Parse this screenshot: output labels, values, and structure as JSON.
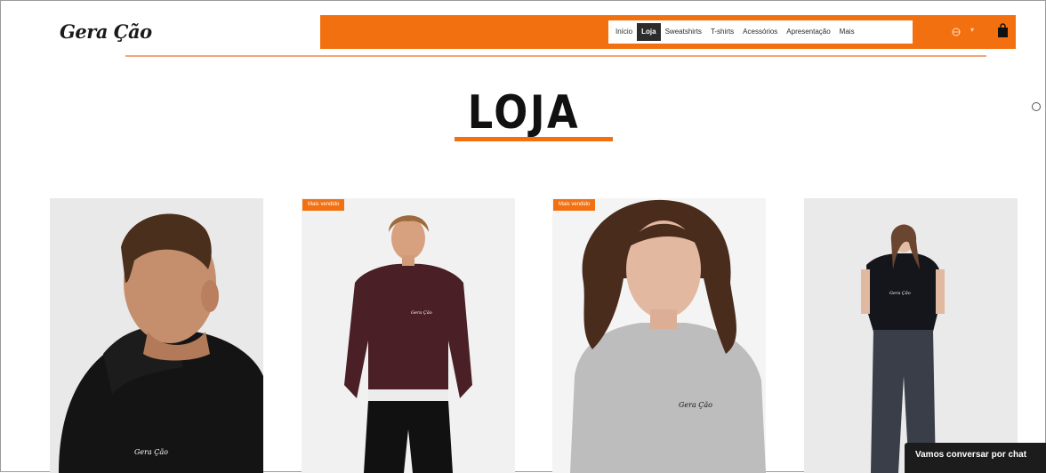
{
  "brand": {
    "logo_text": "Gera Ção"
  },
  "nav": {
    "items": [
      {
        "label": "Início",
        "active": false
      },
      {
        "label": "Loja",
        "active": true
      },
      {
        "label": "Sweatshirts",
        "active": false
      },
      {
        "label": "T-shirts",
        "active": false
      },
      {
        "label": "Acessórios",
        "active": false
      },
      {
        "label": "Apresentação",
        "active": false
      },
      {
        "label": "Mais",
        "active": false
      }
    ],
    "language_icon": "globe-icon",
    "cart_icon": "shopping-bag-icon"
  },
  "page": {
    "title": "LOJA"
  },
  "products": [
    {
      "badge": "",
      "name": "black-hoodie"
    },
    {
      "badge": "Mais vendido",
      "name": "burgundy-sweatshirt"
    },
    {
      "badge": "Mais vendido",
      "name": "grey-tshirt"
    },
    {
      "badge": "",
      "name": "black-tshirt"
    }
  ],
  "chat": {
    "label": "Vamos conversar por chat"
  },
  "colors": {
    "accent": "#f2700f",
    "dark": "#1c1c1c"
  }
}
